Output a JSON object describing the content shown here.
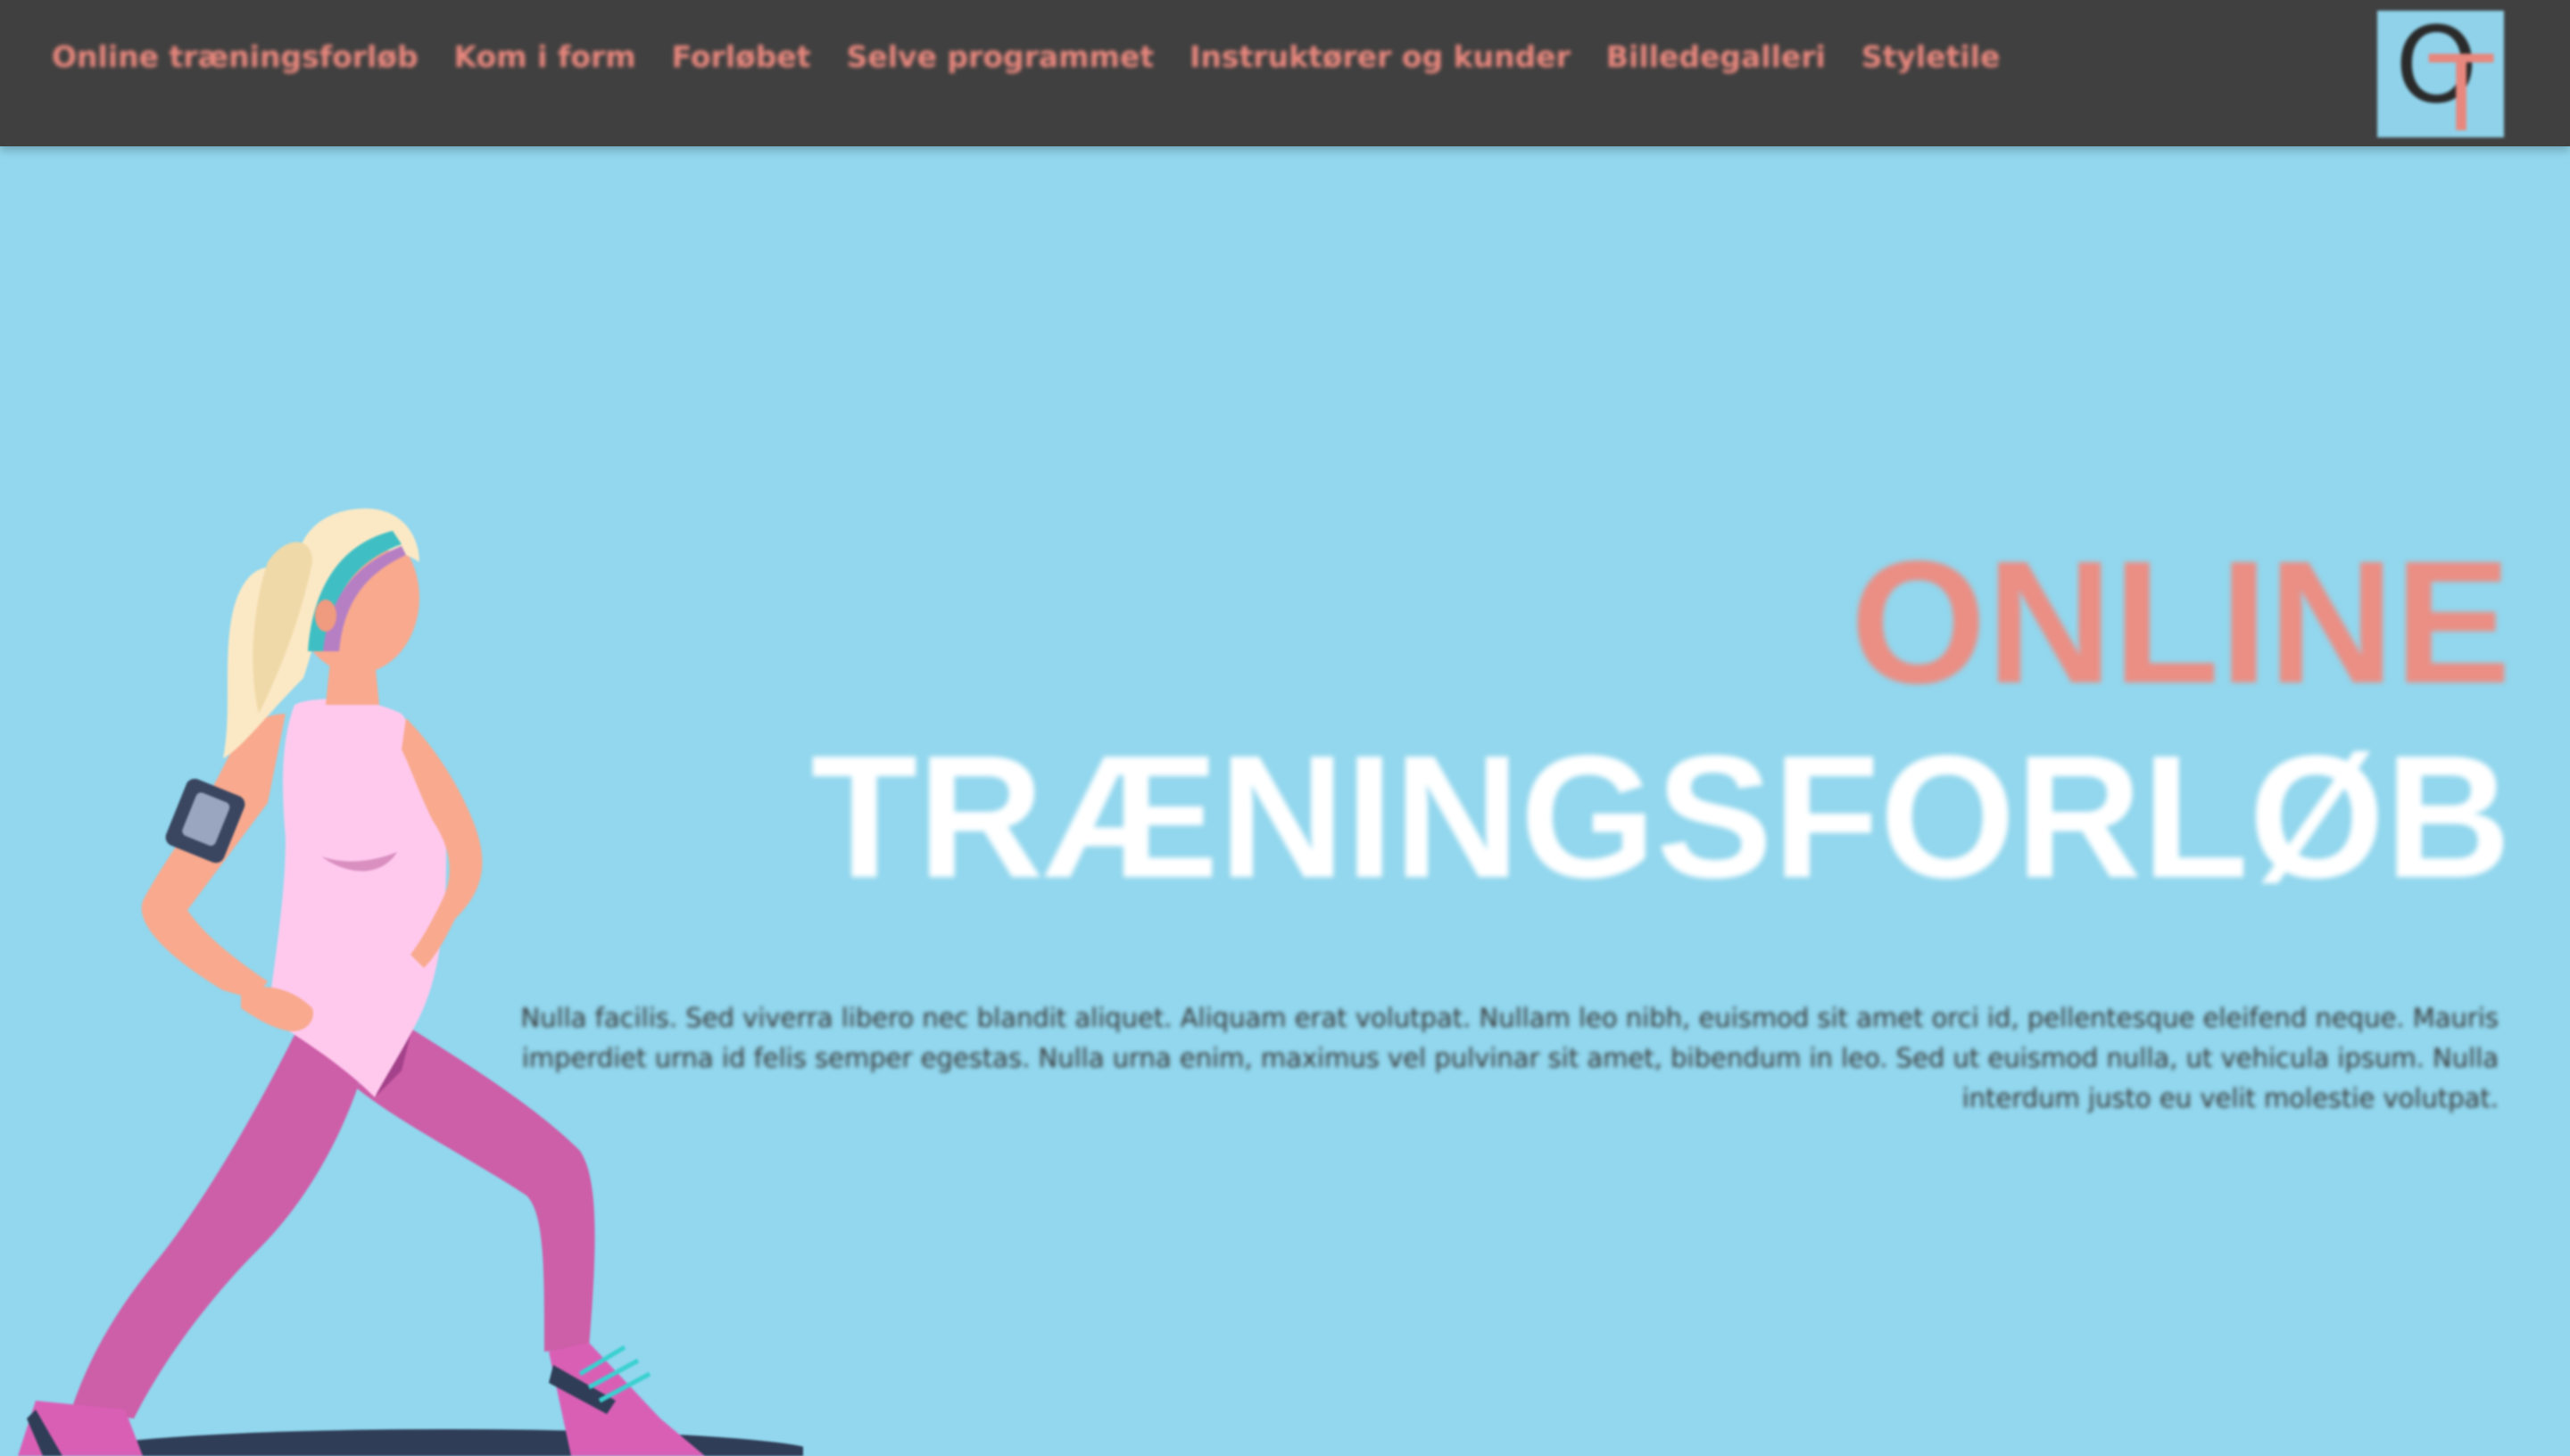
{
  "nav": {
    "items": [
      {
        "label": "Online træningsforløb"
      },
      {
        "label": "Kom i form"
      },
      {
        "label": "Forløbet"
      },
      {
        "label": "Selve programmet"
      },
      {
        "label": "Instruktører og kunder"
      },
      {
        "label": "Billedegalleri"
      },
      {
        "label": "Styletile"
      }
    ]
  },
  "logo": {
    "letter1": "O",
    "letter2": "T"
  },
  "hero": {
    "title_line1": "ONLINE",
    "title_line2": "TRÆNINGSFORLØB",
    "body": "Nulla facilis. Sed viverra libero nec blandit aliquet. Aliquam erat volutpat. Nullam leo nibh, euismod sit amet orci id, pellentesque eleifend neque. Mauris imperdiet urna id felis semper egestas. Nulla urna enim, maximus vel pulvinar sit amet, bibendum in leo. Sed ut euismod nulla, ut vehicula ipsum. Nulla interdum justo eu velit molestie volutpat.",
    "illustration": "woman-exercising-lunge-illustration"
  },
  "colors": {
    "background": "#92d7ee",
    "navbar": "#404040",
    "accent": "#e8877d",
    "title_white": "#ffffff"
  }
}
